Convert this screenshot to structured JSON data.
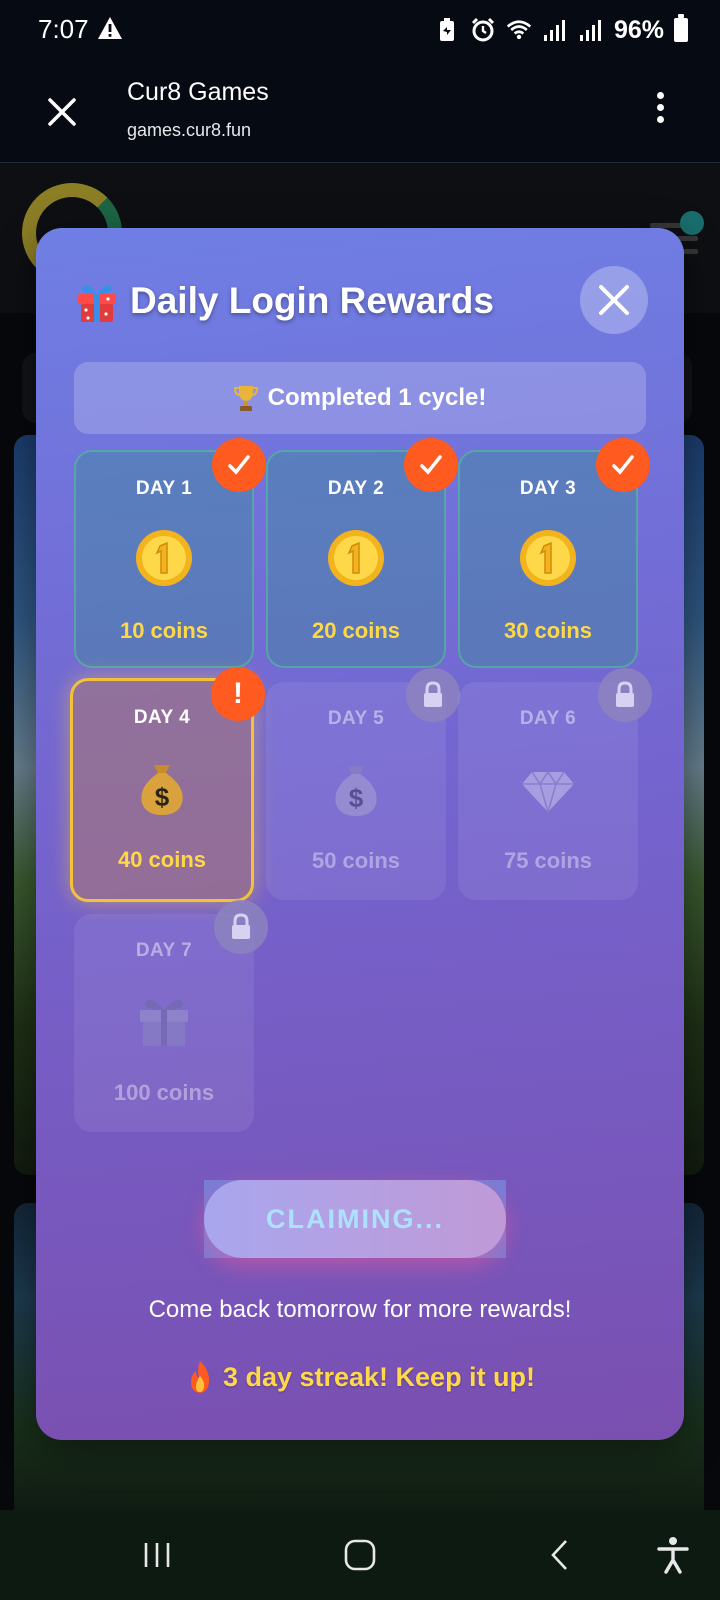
{
  "status_bar": {
    "time": "7:07",
    "battery": "96%",
    "icons": [
      "warning-icon",
      "battery-saver-icon",
      "alarm-icon",
      "wifi-icon",
      "signal-icon",
      "signal-icon",
      "battery-icon"
    ]
  },
  "browser": {
    "title": "Cur8 Games",
    "url": "games.cur8.fun",
    "close_icon": "close-icon",
    "menu_icon": "more-vert-icon"
  },
  "modal": {
    "title": "Daily Login Rewards",
    "title_icon": "gift-icon",
    "banner": "Completed 1 cycle!",
    "banner_icon": "trophy-icon",
    "days": [
      {
        "label": "DAY 1",
        "amount": "10 coins",
        "state": "claimed",
        "icon": "coin-icon"
      },
      {
        "label": "DAY 2",
        "amount": "20 coins",
        "state": "claimed",
        "icon": "coin-icon"
      },
      {
        "label": "DAY 3",
        "amount": "30 coins",
        "state": "claimed",
        "icon": "coin-icon"
      },
      {
        "label": "DAY 4",
        "amount": "40 coins",
        "state": "current",
        "icon": "money-bag-icon"
      },
      {
        "label": "DAY 5",
        "amount": "50 coins",
        "state": "locked",
        "icon": "money-bag-icon"
      },
      {
        "label": "DAY 6",
        "amount": "75 coins",
        "state": "locked",
        "icon": "diamond-icon"
      },
      {
        "label": "DAY 7",
        "amount": "100 coins",
        "state": "locked",
        "icon": "gift-icon"
      }
    ],
    "current_badge": "!",
    "claim_button": "CLAIMING...",
    "come_back": "Come back tomorrow for more rewards!",
    "streak": "3 day streak! Keep it up!",
    "streak_icon": "fire-icon"
  },
  "colors": {
    "accent_badge": "#ff5a1f",
    "coin_text": "#ffd84a",
    "current_border": "#f3c23a"
  },
  "navbar": {
    "icons": [
      "recents-icon",
      "home-icon",
      "back-icon",
      "accessibility-icon"
    ]
  }
}
